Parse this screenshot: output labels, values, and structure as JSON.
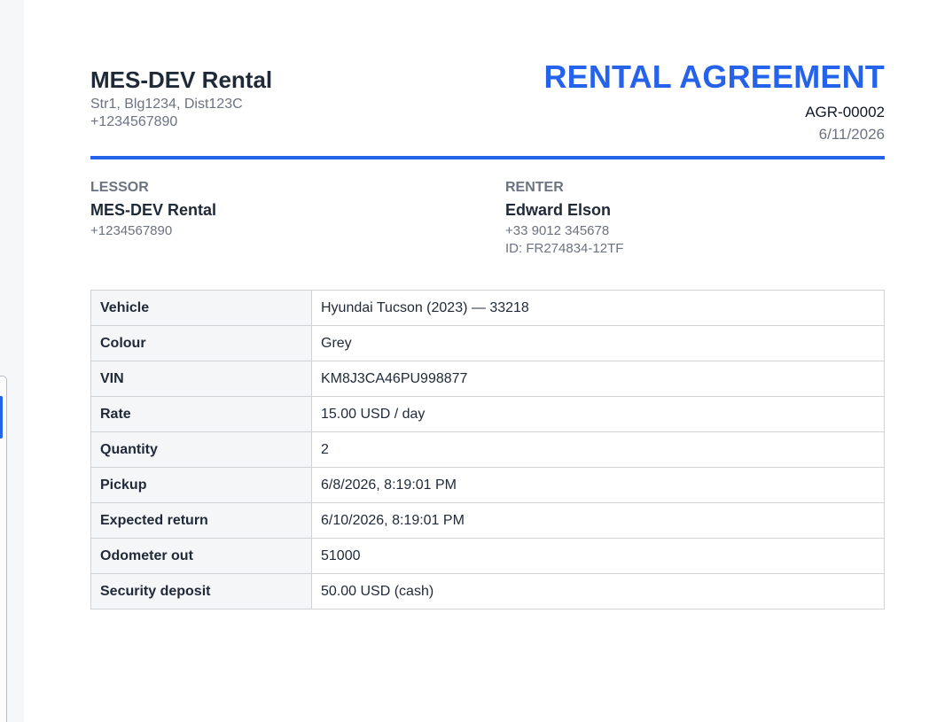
{
  "viewer": {
    "accent_color": "#2563eb"
  },
  "company": {
    "name": "MES-DEV Rental",
    "address": "Str1, Blg1234, Dist123C",
    "phone": "+1234567890"
  },
  "agreement": {
    "title": "RENTAL AGREEMENT",
    "number": "AGR-00002",
    "date": "6/11/2026"
  },
  "parties": {
    "lessor": {
      "label": "LESSOR",
      "name": "MES-DEV Rental",
      "phone": "+1234567890"
    },
    "renter": {
      "label": "RENTER",
      "name": "Edward Elson",
      "phone": "+33 9012 345678",
      "id": "ID: FR274834-12TF"
    }
  },
  "details": {
    "rows": [
      {
        "label": "Vehicle",
        "value": "Hyundai Tucson (2023) — 33218"
      },
      {
        "label": "Colour",
        "value": "Grey"
      },
      {
        "label": "VIN",
        "value": "KM8J3CA46PU998877"
      },
      {
        "label": "Rate",
        "value": "15.00 USD / day"
      },
      {
        "label": "Quantity",
        "value": "2"
      },
      {
        "label": "Pickup",
        "value": "6/8/2026, 8:19:01 PM"
      },
      {
        "label": "Expected return",
        "value": "6/10/2026, 8:19:01 PM"
      },
      {
        "label": "Odometer out",
        "value": "51000"
      },
      {
        "label": "Security deposit",
        "value": "50.00 USD (cash)"
      }
    ]
  }
}
